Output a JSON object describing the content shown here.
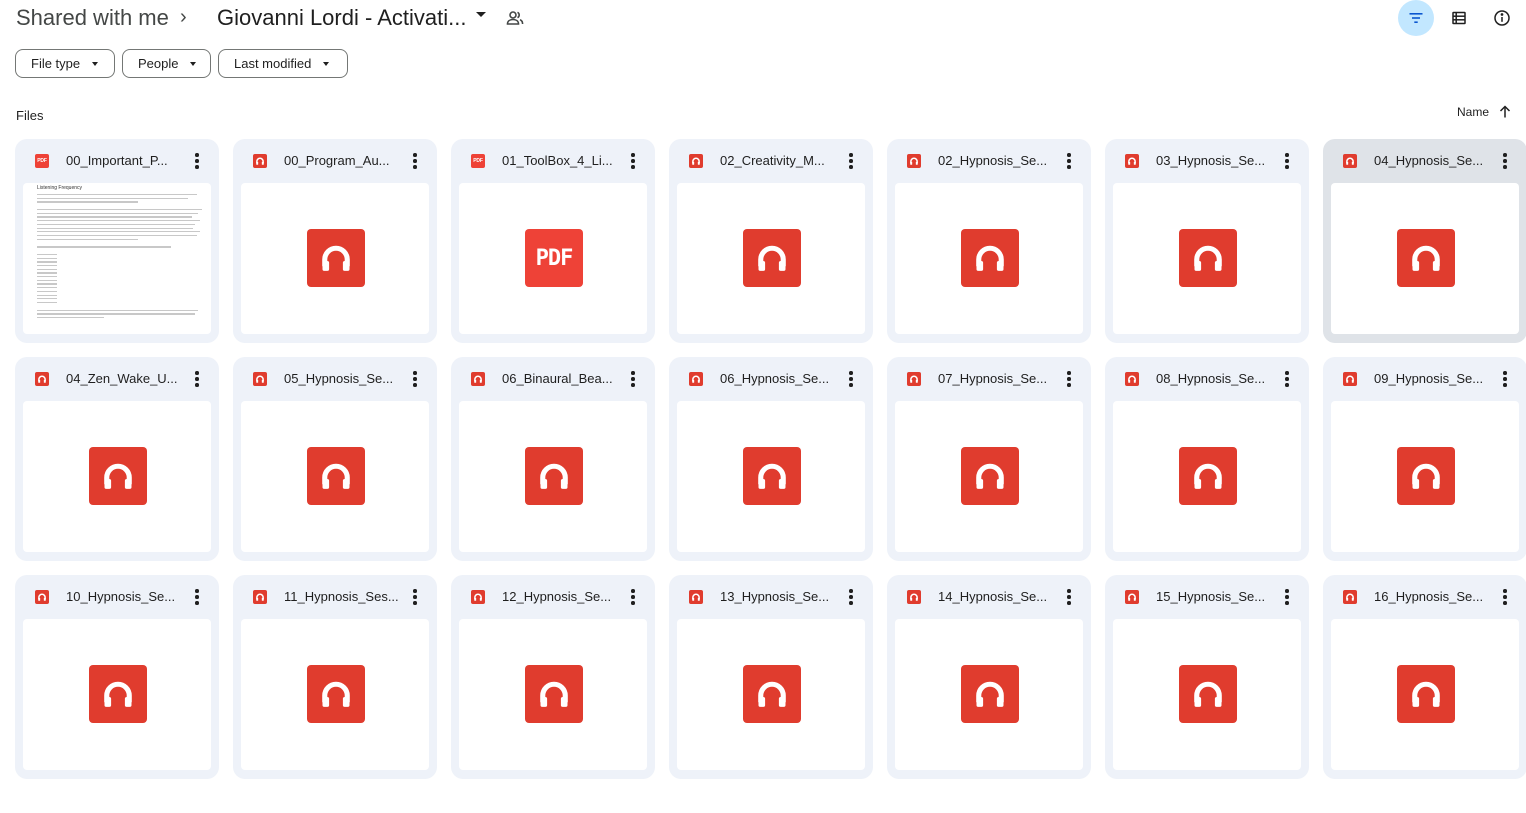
{
  "breadcrumb": {
    "root": "Shared with me",
    "separator": "›",
    "current": "Giovanni Lordi - Activati..."
  },
  "toolbar": {
    "icons": [
      "filter-icon",
      "list-view-icon",
      "info-icon"
    ],
    "active_color": "#c2e7ff"
  },
  "filters": {
    "file_type": "File type",
    "people": "People",
    "last_modified": "Last modified"
  },
  "section": {
    "label": "Files",
    "sort_label": "Name",
    "sort_direction": "ascending"
  },
  "colors": {
    "audio_red": "#e03c2e",
    "pdf_red": "#ee4237",
    "card_bg": "#eef2f9",
    "card_selected": "#dfe3e8"
  },
  "preview": {
    "heading": "Listening Frequency"
  },
  "files": [
    {
      "name": "00_Important_P...",
      "type": "pdf",
      "preview": "document",
      "selected": false
    },
    {
      "name": "00_Program_Au...",
      "type": "audio",
      "preview": "icon",
      "selected": false
    },
    {
      "name": "01_ToolBox_4_Li...",
      "type": "pdf",
      "preview": "pdf-icon",
      "selected": false
    },
    {
      "name": "02_Creativity_M...",
      "type": "audio",
      "preview": "icon",
      "selected": false
    },
    {
      "name": "02_Hypnosis_Se...",
      "type": "audio",
      "preview": "icon",
      "selected": false
    },
    {
      "name": "03_Hypnosis_Se...",
      "type": "audio",
      "preview": "icon",
      "selected": false
    },
    {
      "name": "04_Hypnosis_Se...",
      "type": "audio",
      "preview": "icon",
      "selected": true
    },
    {
      "name": "04_Zen_Wake_U...",
      "type": "audio",
      "preview": "icon",
      "selected": false
    },
    {
      "name": "05_Hypnosis_Se...",
      "type": "audio",
      "preview": "icon",
      "selected": false
    },
    {
      "name": "06_Binaural_Bea...",
      "type": "audio",
      "preview": "icon",
      "selected": false
    },
    {
      "name": "06_Hypnosis_Se...",
      "type": "audio",
      "preview": "icon",
      "selected": false
    },
    {
      "name": "07_Hypnosis_Se...",
      "type": "audio",
      "preview": "icon",
      "selected": false
    },
    {
      "name": "08_Hypnosis_Se...",
      "type": "audio",
      "preview": "icon",
      "selected": false
    },
    {
      "name": "09_Hypnosis_Se...",
      "type": "audio",
      "preview": "icon",
      "selected": false
    },
    {
      "name": "10_Hypnosis_Se...",
      "type": "audio",
      "preview": "icon",
      "selected": false
    },
    {
      "name": "11_Hypnosis_Ses...",
      "type": "audio",
      "preview": "icon",
      "selected": false
    },
    {
      "name": "12_Hypnosis_Se...",
      "type": "audio",
      "preview": "icon",
      "selected": false
    },
    {
      "name": "13_Hypnosis_Se...",
      "type": "audio",
      "preview": "icon",
      "selected": false
    },
    {
      "name": "14_Hypnosis_Se...",
      "type": "audio",
      "preview": "icon",
      "selected": false
    },
    {
      "name": "15_Hypnosis_Se...",
      "type": "audio",
      "preview": "icon",
      "selected": false
    },
    {
      "name": "16_Hypnosis_Se...",
      "type": "audio",
      "preview": "icon",
      "selected": false
    }
  ]
}
